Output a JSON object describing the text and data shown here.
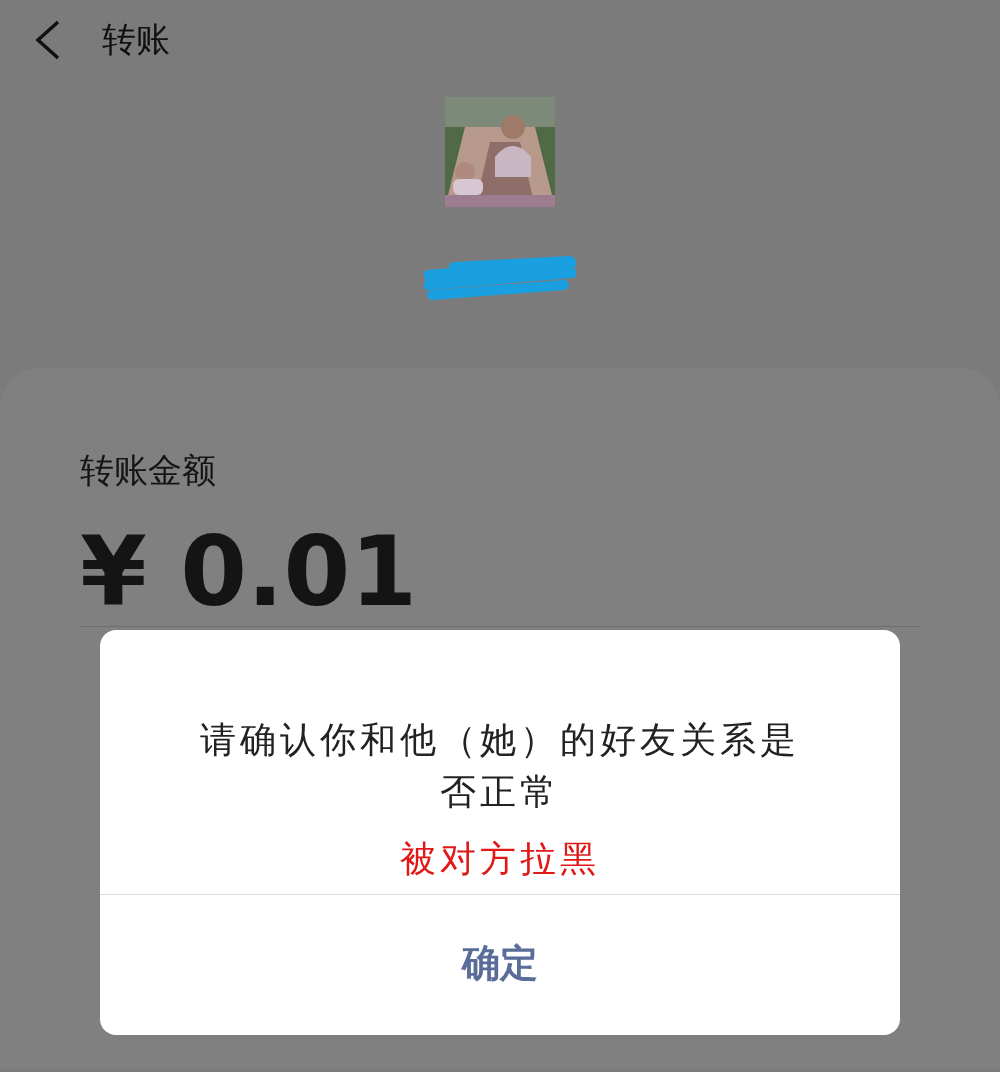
{
  "header": {
    "title": "转账"
  },
  "amount_card": {
    "label": "转账金额",
    "amount": "¥ 0.01"
  },
  "dialog": {
    "message": "请确认你和他（她）的好友关系是否正常",
    "annotation": "被对方拉黑",
    "buttons": [
      "确定"
    ]
  }
}
